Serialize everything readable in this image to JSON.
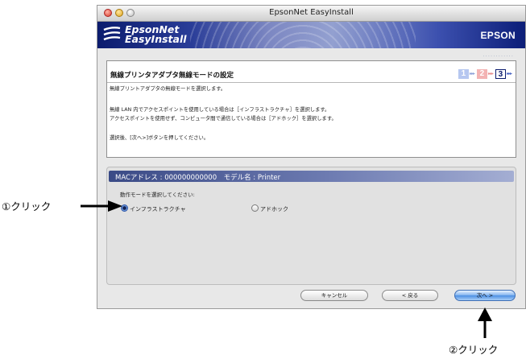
{
  "window": {
    "title": "EpsonNet EasyInstall"
  },
  "banner": {
    "logo_line1": "EpsonNet",
    "logo_line2": "EasyInstall",
    "brand": "EPSON",
    "dots": "............"
  },
  "header": {
    "title": "無線プリンタアダプタ無線モードの設定",
    "steps": [
      "1",
      "2",
      "3"
    ],
    "step_arrows": "▸▸▸"
  },
  "description": {
    "lines": [
      "無線プリントアダプタの無線モードを選択します。",
      "",
      "無線 LAN 内でアクセスポイントを使用している場合は［インフラストラクチャ］を選択します。",
      "アクセスポイントを使用せず、コンピュータ間で通信している場合は［アドホック］を選択します。",
      "",
      "選択後、[次へ>]ボタンを押してください。"
    ]
  },
  "device": {
    "mac_info": "MACアドレス : 000000000000　モデル名 : Printer"
  },
  "mode": {
    "prompt": "動作モードを選択してください:",
    "options": [
      {
        "label": "インフラストラクチャ",
        "selected": true
      },
      {
        "label": "アドホック",
        "selected": false
      }
    ]
  },
  "buttons": {
    "cancel": "キャンセル",
    "back": "< 戻る",
    "next": "次へ >"
  },
  "annotations": {
    "click1": "①クリック",
    "click2": "②クリック"
  },
  "colors": {
    "banner": "#1a2a88",
    "accent": "#4c8fe3",
    "step1": "#b6c7f0",
    "step2": "#f3b3b3"
  }
}
